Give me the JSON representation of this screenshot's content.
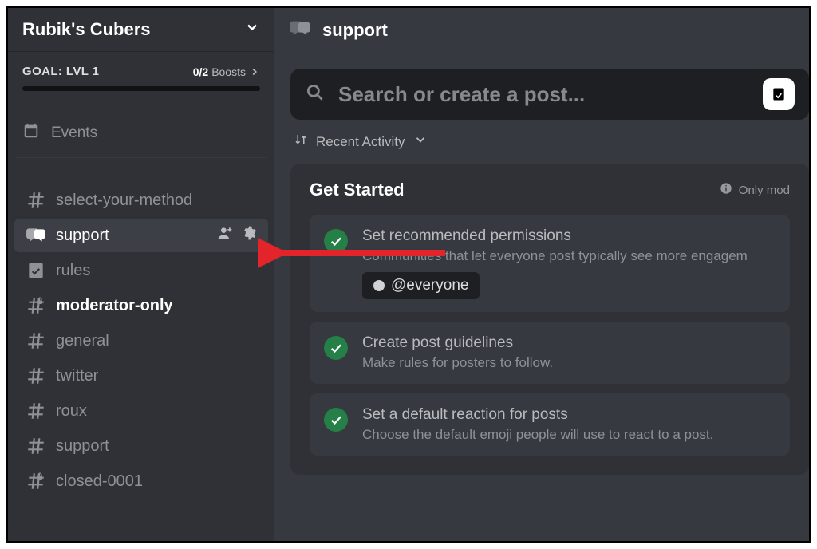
{
  "server": {
    "name": "Rubik's Cubers"
  },
  "boost": {
    "goal_label": "GOAL: LVL 1",
    "count_num": "0/2",
    "count_label": "Boosts"
  },
  "events_label": "Events",
  "channels": [
    {
      "icon": "hash",
      "name": "select-your-method"
    },
    {
      "icon": "forum",
      "name": "support",
      "active": true
    },
    {
      "icon": "rules",
      "name": "rules"
    },
    {
      "icon": "hash-lock",
      "name": "moderator-only",
      "bold": true
    },
    {
      "icon": "hash",
      "name": "general"
    },
    {
      "icon": "hash",
      "name": "twitter"
    },
    {
      "icon": "hash",
      "name": "roux"
    },
    {
      "icon": "hash",
      "name": "support"
    },
    {
      "icon": "hash-lock",
      "name": "closed-0001"
    }
  ],
  "header": {
    "channel_name": "support"
  },
  "search": {
    "placeholder": "Search or create a post..."
  },
  "sort": {
    "label": "Recent Activity"
  },
  "panel": {
    "title": "Get Started",
    "only_mod": "Only mod",
    "cards": [
      {
        "title": "Set recommended permissions",
        "sub": "Communities that let everyone post typically see more engagem",
        "chip": "@everyone"
      },
      {
        "title": "Create post guidelines",
        "sub": "Make rules for posters to follow."
      },
      {
        "title": "Set a default reaction for posts",
        "sub": "Choose the default emoji people will use to react to a post."
      }
    ]
  }
}
